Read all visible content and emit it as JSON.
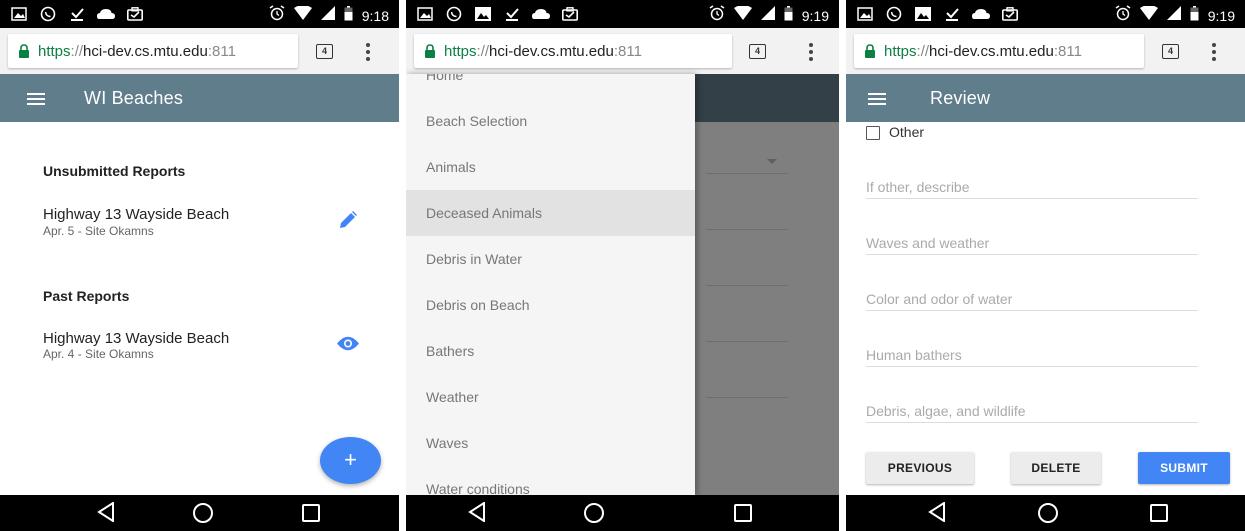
{
  "colors": {
    "app_bar": "#607d8b",
    "app_bar_dimmed": "#334048",
    "accent_blue": "#4285f4",
    "url_scheme_green": "#0b8043",
    "drawer_active": "#e2e2e2"
  },
  "screens": [
    {
      "status_bar": {
        "time": "9:18",
        "icons": [
          "image-icon",
          "whatsapp-icon",
          "download-icon",
          "cloud-icon",
          "briefcase-icon",
          "alarm-icon",
          "wifi-icon",
          "signal-icon",
          "battery-icon"
        ]
      },
      "browser": {
        "url_scheme": "https",
        "url_sep": "://",
        "url_host": "hci-dev.cs.mtu.edu",
        "url_port": ":811",
        "tab_count": "4"
      },
      "app_bar": {
        "title": "WI Beaches"
      },
      "sections": [
        {
          "title": "Unsubmitted Reports",
          "reports": [
            {
              "title": "Highway 13 Wayside Beach",
              "subtitle": "Apr. 5 - Site Okamns",
              "action_icon": "pencil-icon"
            }
          ]
        },
        {
          "title": "Past Reports",
          "reports": [
            {
              "title": "Highway 13 Wayside Beach",
              "subtitle": "Apr. 4 - Site Okamns",
              "action_icon": "eye-icon"
            }
          ]
        }
      ],
      "fab_label": "+"
    },
    {
      "status_bar": {
        "time": "9:19"
      },
      "browser": {
        "url_scheme": "https",
        "url_sep": "://",
        "url_host": "hci-dev.cs.mtu.edu",
        "url_port": ":811",
        "tab_count": "4"
      },
      "drawer": {
        "items": [
          {
            "label": "Home"
          },
          {
            "label": "Beach Selection"
          },
          {
            "label": "Animals"
          },
          {
            "label": "Deceased Animals",
            "active": true
          },
          {
            "label": "Debris in Water"
          },
          {
            "label": "Debris on Beach"
          },
          {
            "label": "Bathers"
          },
          {
            "label": "Weather"
          },
          {
            "label": "Waves"
          },
          {
            "label": "Water conditions"
          }
        ]
      }
    },
    {
      "status_bar": {
        "time": "9:19"
      },
      "browser": {
        "url_scheme": "https",
        "url_sep": "://",
        "url_host": "hci-dev.cs.mtu.edu",
        "url_port": ":811",
        "tab_count": "4"
      },
      "app_bar": {
        "title": "Review"
      },
      "checkbox": {
        "label": "Other",
        "checked": false
      },
      "fields": [
        {
          "placeholder": "If other, describe"
        },
        {
          "placeholder": "Waves and weather"
        },
        {
          "placeholder": "Color and odor of water"
        },
        {
          "placeholder": "Human bathers"
        },
        {
          "placeholder": "Debris, algae, and wildlife"
        }
      ],
      "buttons": {
        "previous": "PREVIOUS",
        "delete": "DELETE",
        "submit": "SUBMIT"
      }
    }
  ]
}
